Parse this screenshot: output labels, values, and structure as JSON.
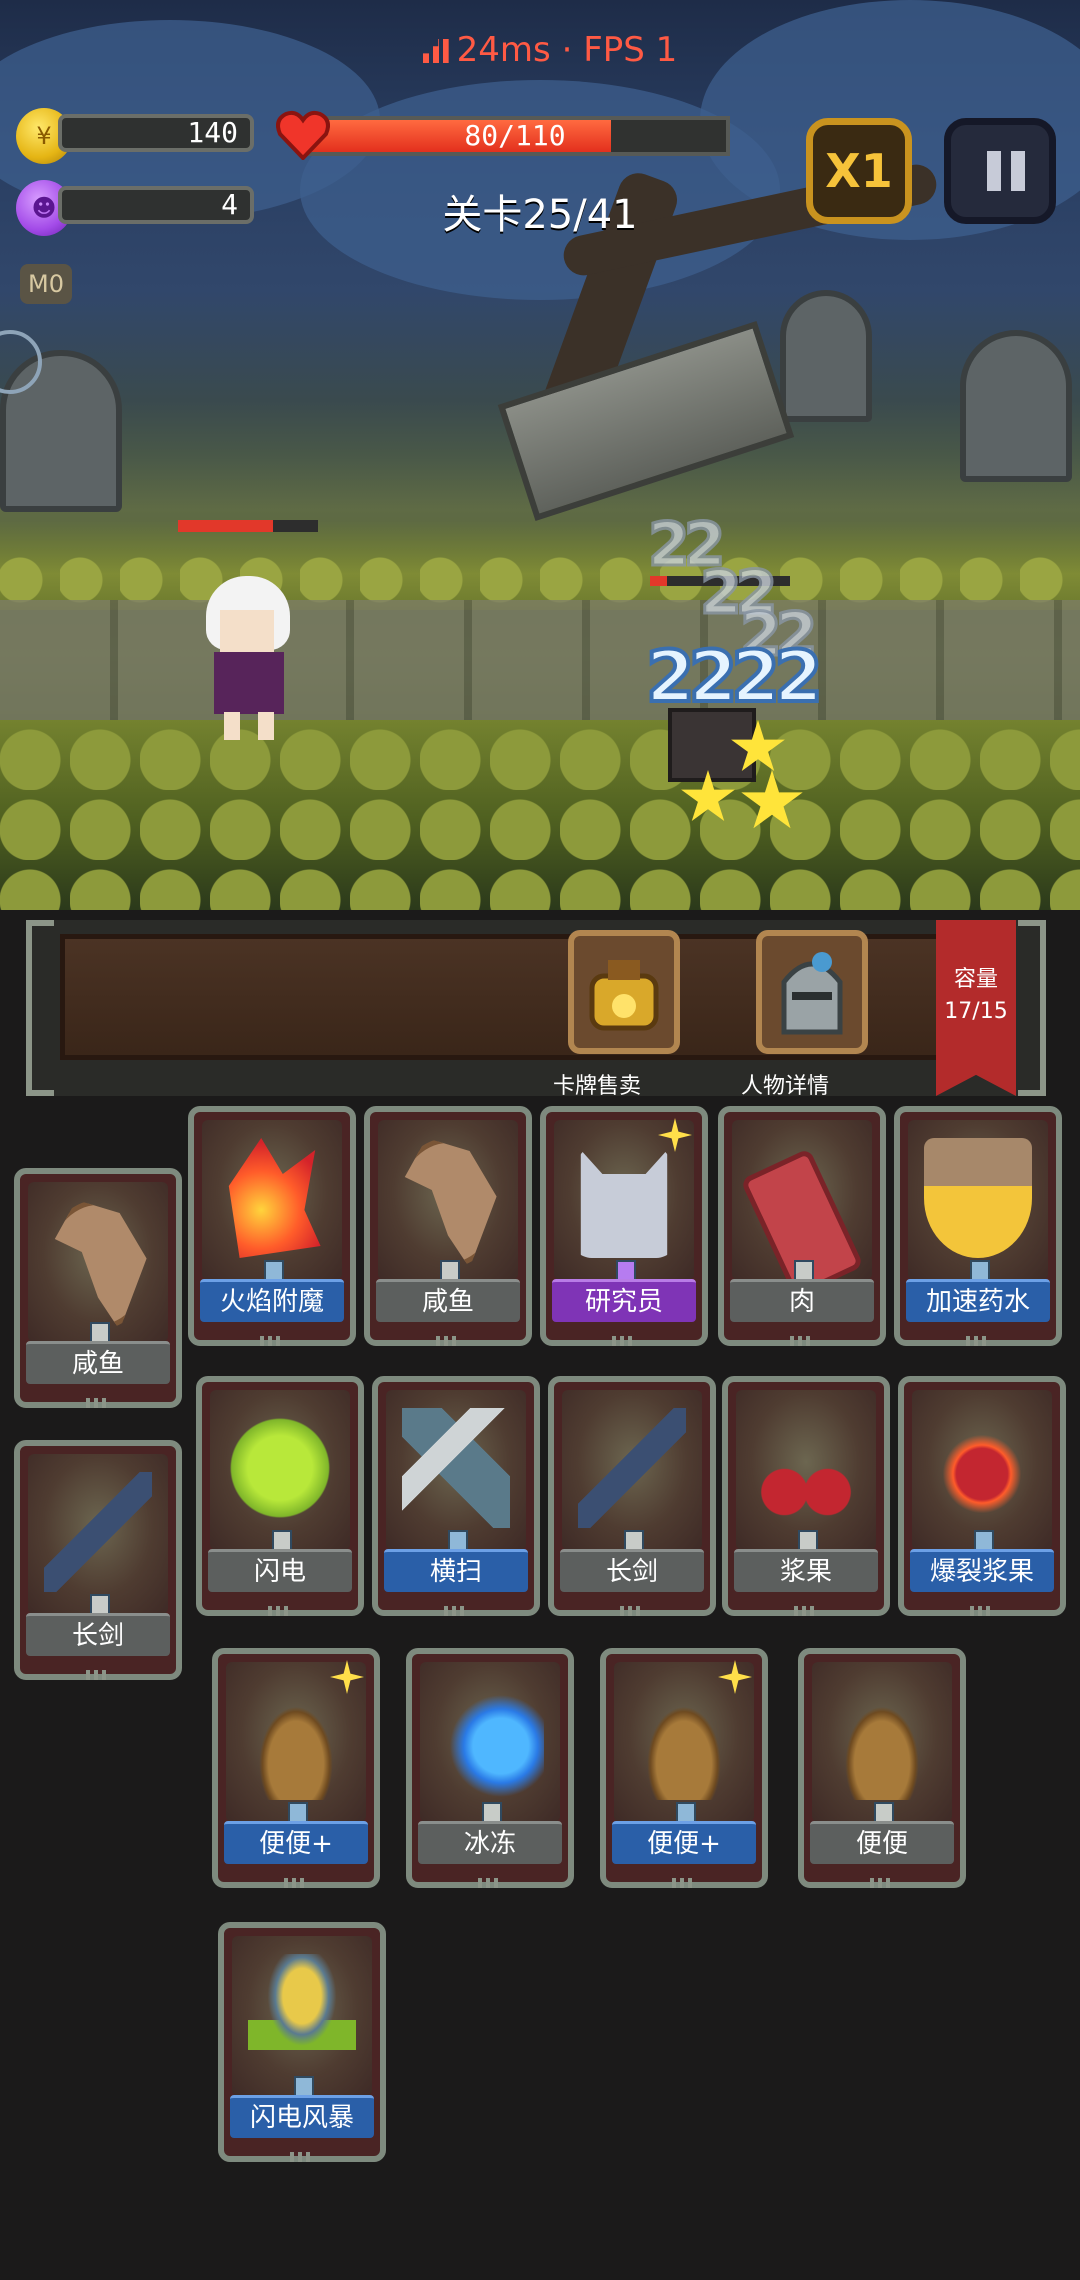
{
  "hud": {
    "ping": "24ms",
    "separator": "·",
    "fps": "FPS 1",
    "gold": "140",
    "gems": "4",
    "hp_text": "80/110",
    "hp_fraction": 0.727,
    "stage": "关卡25/41",
    "speed_label": "X1",
    "mode_chip": "M0"
  },
  "battle": {
    "damage_numbers": [
      "22",
      "22",
      "22",
      "2222"
    ],
    "hero_hp_fraction": 0.68,
    "enemy_hp_fraction": 0.12
  },
  "shelf": {
    "sell_label": "卡牌售卖",
    "details_label": "人物详情",
    "capacity_title": "容量",
    "capacity_value": "17/15"
  },
  "cards": [
    {
      "label": "咸鱼",
      "icon": "salted-fish-icon",
      "style": "gray"
    },
    {
      "label": "火焰附魔",
      "icon": "fire-enchant-icon",
      "style": "blue"
    },
    {
      "label": "咸鱼",
      "icon": "salted-fish-icon",
      "style": "gray"
    },
    {
      "label": "研究员",
      "icon": "researcher-cat-icon",
      "style": "purple"
    },
    {
      "label": "肉",
      "icon": "meat-icon",
      "style": "gray"
    },
    {
      "label": "加速药水",
      "icon": "speed-potion-icon",
      "style": "blue"
    },
    {
      "label": "长剑",
      "icon": "long-sword-icon",
      "style": "gray"
    },
    {
      "label": "闪电",
      "icon": "lightning-icon",
      "style": "gray"
    },
    {
      "label": "横扫",
      "icon": "sweep-icon",
      "style": "blue"
    },
    {
      "label": "长剑",
      "icon": "long-sword-icon",
      "style": "gray"
    },
    {
      "label": "浆果",
      "icon": "berry-icon",
      "style": "gray"
    },
    {
      "label": "爆裂浆果",
      "icon": "burst-berry-icon",
      "style": "blue"
    },
    {
      "label": "便便+",
      "icon": "poop-icon",
      "style": "blue"
    },
    {
      "label": "冰冻",
      "icon": "ice-icon",
      "style": "gray"
    },
    {
      "label": "便便+",
      "icon": "poop-icon",
      "style": "blue"
    },
    {
      "label": "便便",
      "icon": "poop-icon",
      "style": "gray"
    },
    {
      "label": "闪电风暴",
      "icon": "lightning-storm-icon",
      "style": "blue"
    }
  ]
}
